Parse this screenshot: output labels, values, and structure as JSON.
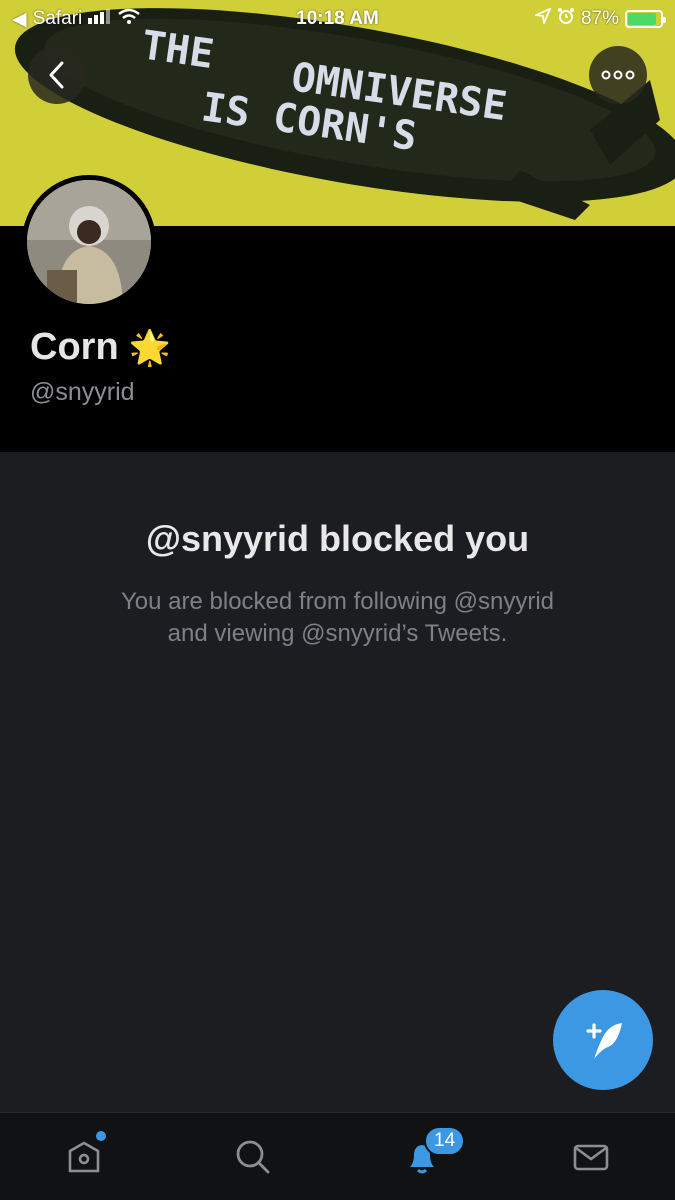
{
  "status_bar": {
    "back_app": "Safari",
    "time": "10:18 AM",
    "battery_percent": "87%",
    "battery_level": 0.87
  },
  "banner": {
    "line1": "THE",
    "line2": "OMNIVERSE",
    "line3": "IS CORN'S"
  },
  "profile": {
    "display_name": "Corn",
    "emoji": "🌟",
    "handle": "@snyyrid"
  },
  "blocked": {
    "title": "@snyyrid blocked you",
    "description_line1": "You are blocked from following @snyyrid",
    "description_line2": "and viewing @snyyrid’s Tweets."
  },
  "tab_bar": {
    "tabs": [
      {
        "name": "home",
        "icon": "home-icon"
      },
      {
        "name": "search",
        "icon": "search-icon"
      },
      {
        "name": "notifications",
        "icon": "bell-icon"
      },
      {
        "name": "messages",
        "icon": "mail-icon"
      }
    ],
    "notification_count": "14"
  },
  "colors": {
    "accent": "#3d98e3",
    "panel_bg": "#1c1d21",
    "banner_yellow": "#d8d640"
  }
}
